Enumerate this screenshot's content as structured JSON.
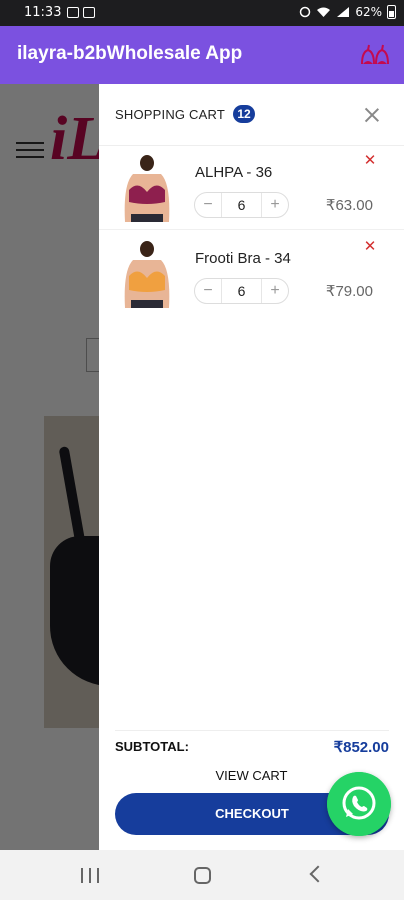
{
  "status_bar": {
    "time": "11:33",
    "battery": "62%",
    "left_icons": [
      "image-icon",
      "message-icon"
    ],
    "right_icons": [
      "alarm-icon",
      "wifi-icon",
      "signal-icon",
      "battery-icon"
    ]
  },
  "app_bar": {
    "title": "ilayra-b2bWholesale App",
    "icon": "bra-icon"
  },
  "background": {
    "logo_text": "iL"
  },
  "cart": {
    "title": "SHOPPING CART",
    "count": "12",
    "items": [
      {
        "name": "ALHPA - 36",
        "quantity": "6",
        "price": "₹63.00",
        "image_color": "#8e1f4e"
      },
      {
        "name": "Frooti Bra - 34",
        "quantity": "6",
        "price": "₹79.00",
        "image_color": "#f0a040"
      }
    ],
    "subtotal_label": "SUBTOTAL:",
    "subtotal_value": "₹852.00",
    "view_cart_label": "VIEW CART",
    "checkout_label": "CHECKOUT"
  },
  "colors": {
    "app_bar": "#7b51e0",
    "accent_blue": "#163d9c",
    "remove_red": "#d32f2f",
    "whatsapp_green": "#25d366"
  },
  "nav_bar": {
    "icons": [
      "recent-apps-icon",
      "home-icon",
      "back-icon"
    ]
  }
}
